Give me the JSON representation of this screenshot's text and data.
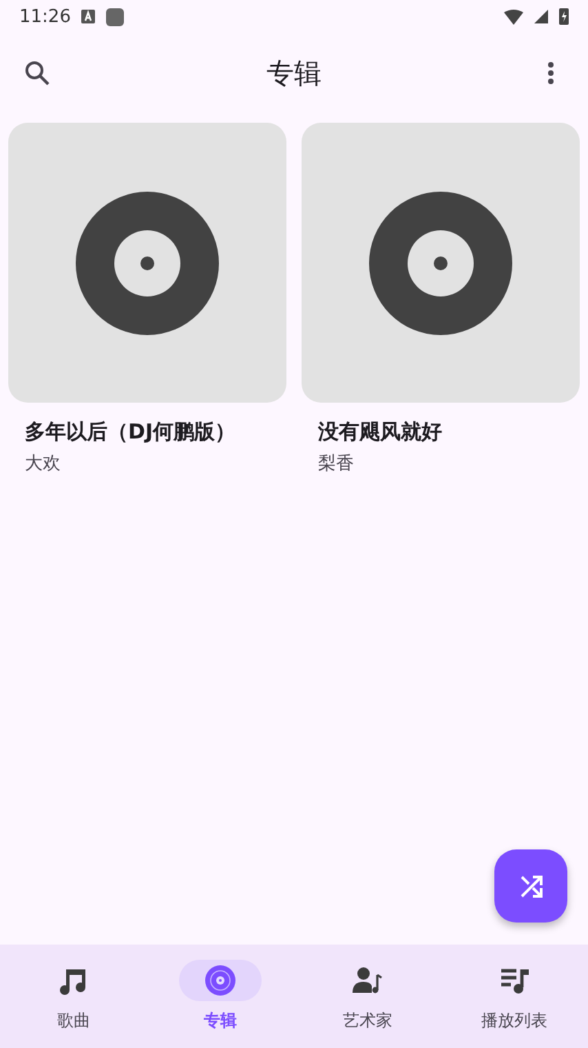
{
  "status_bar": {
    "time": "11:26"
  },
  "top_bar": {
    "title": "专辑"
  },
  "albums": [
    {
      "title": "多年以后（DJ何鹏版）",
      "artist": "大欢"
    },
    {
      "title": "没有飓风就好",
      "artist": "梨香"
    }
  ],
  "bottom_nav": [
    {
      "label": "歌曲",
      "selected": false
    },
    {
      "label": "专辑",
      "selected": true
    },
    {
      "label": "艺术家",
      "selected": false
    },
    {
      "label": "播放列表",
      "selected": false
    }
  ]
}
